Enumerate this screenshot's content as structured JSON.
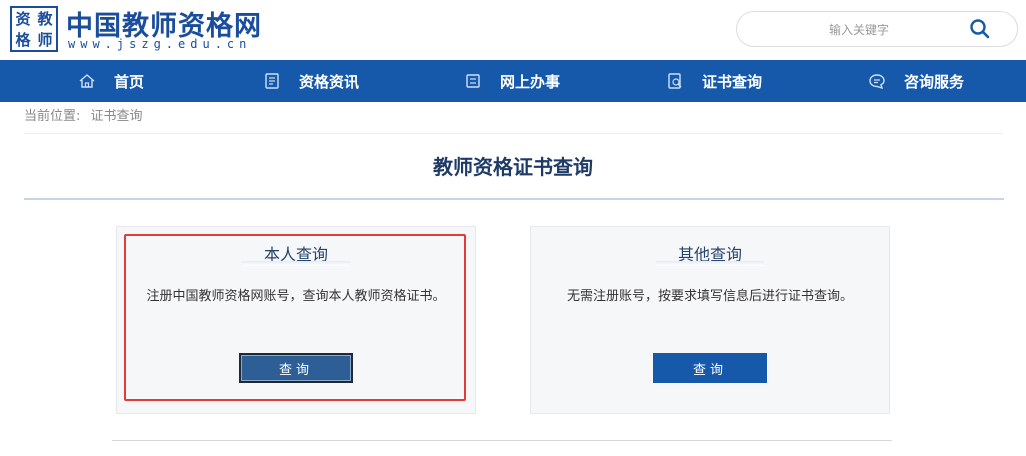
{
  "header": {
    "logo_chars": [
      "资",
      "教",
      "格",
      "师"
    ],
    "site_title": "中国教师资格网",
    "site_url": "www.jszg.edu.cn",
    "search": {
      "placeholder": "输入关键字",
      "value": ""
    }
  },
  "nav": {
    "items": [
      {
        "label": "首页",
        "icon": "home-icon"
      },
      {
        "label": "资格资讯",
        "icon": "news-icon"
      },
      {
        "label": "网上办事",
        "icon": "online-service-icon"
      },
      {
        "label": "证书查询",
        "icon": "certificate-query-icon"
      },
      {
        "label": "咨询服务",
        "icon": "chat-icon"
      }
    ]
  },
  "breadcrumb": {
    "prefix": "当前位置:",
    "current": "证书查询"
  },
  "page": {
    "title": "教师资格证书查询"
  },
  "cards": [
    {
      "title": "本人查询",
      "description": "注册中国教师资格网账号，查询本人教师资格证书。",
      "button": "查询"
    },
    {
      "title": "其他查询",
      "description": "无需注册账号，按要求填写信息后进行证书查询。",
      "button": "查询"
    }
  ],
  "colors": {
    "brand": "#1659ab",
    "title": "#1e3b68",
    "highlight": "#e33a3a"
  }
}
